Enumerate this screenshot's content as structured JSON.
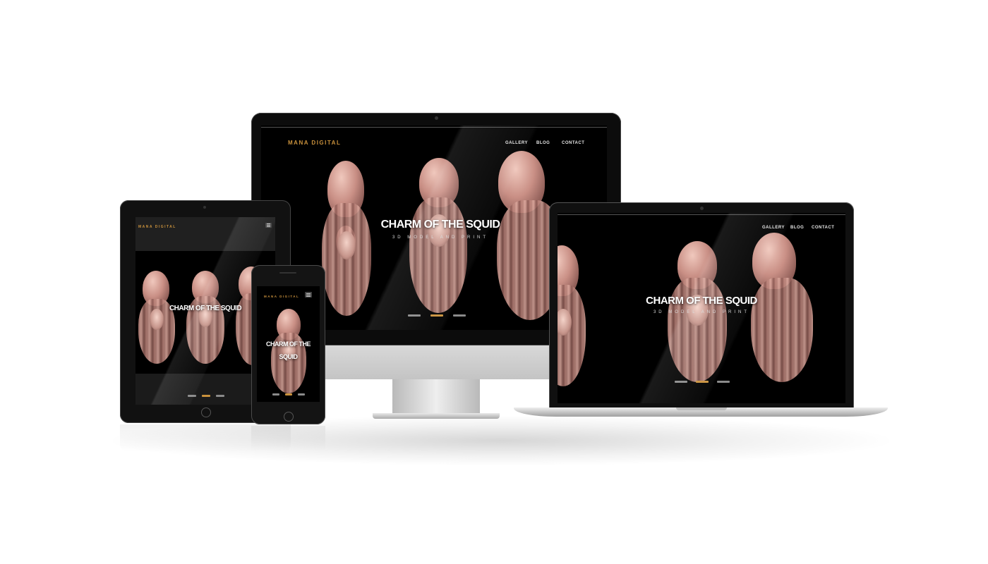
{
  "brand": "MANA DIGITAL",
  "hero": {
    "title": "CHARM OF THE SQUID",
    "subtitle": "3D MODEL AND PRINT",
    "phone_title_line1": "CHARM OF THE",
    "phone_title_line2": "SQUID"
  },
  "nav": [
    {
      "label": "GALLERY"
    },
    {
      "label": "BLOG"
    },
    {
      "label": "CONTACT"
    }
  ],
  "menu_icon": "hamburger-icon",
  "slider_dots": [
    {
      "active": false
    },
    {
      "active": true
    },
    {
      "active": false
    }
  ],
  "colors": {
    "brand": "#c9913c",
    "background": "#000000",
    "sculpture": "#c99086"
  }
}
